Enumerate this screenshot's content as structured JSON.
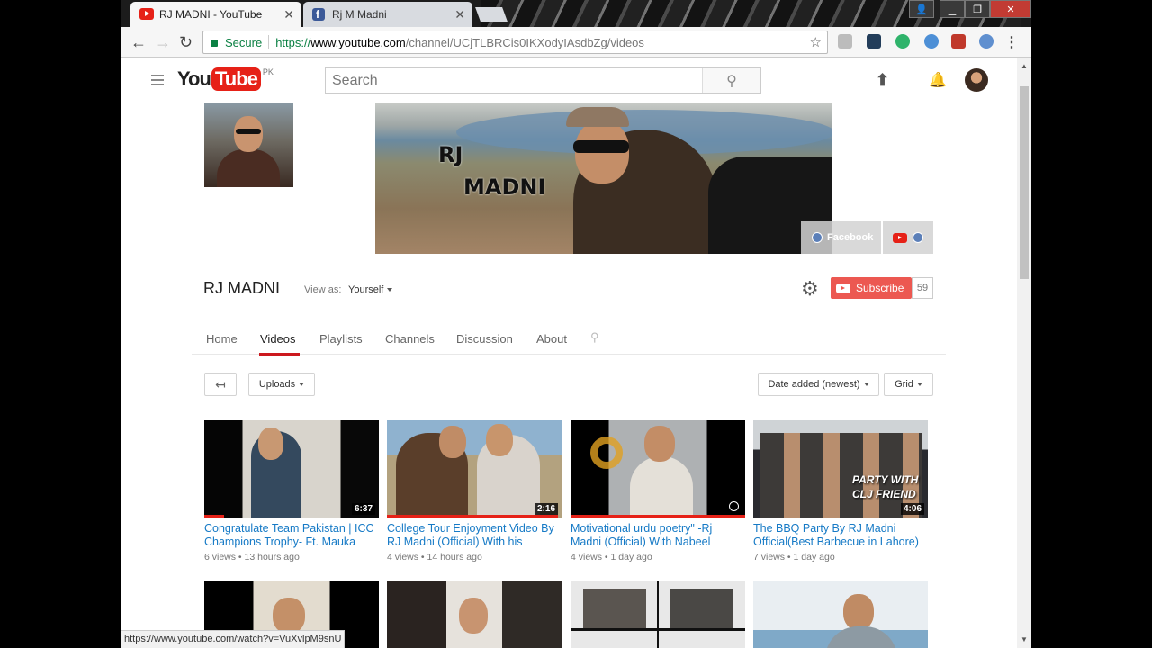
{
  "browser": {
    "tabs": [
      {
        "title": "RJ MADNI - YouTube",
        "active": true
      },
      {
        "title": "Rj M Madni",
        "active": false
      }
    ],
    "address": {
      "secure_label": "Secure",
      "url_scheme": "https://",
      "url_host": "www.youtube.com",
      "url_path": "/channel/UCjTLBRCis0IKXodyIAsdbZg/videos"
    },
    "status_url": "https://www.youtube.com/watch?v=VuXvlpM9snU"
  },
  "masthead": {
    "logo_you": "You",
    "logo_tube": "Tube",
    "region": "PK",
    "search_placeholder": "Search"
  },
  "channel": {
    "name": "RJ MADNI",
    "banner_text_1": "RJ",
    "banner_text_2": "MADNI",
    "links": {
      "facebook": "Facebook"
    },
    "view_as_label": "View as:",
    "view_as_value": "Yourself",
    "subscribe_label": "Subscribe",
    "subscriber_count": "59",
    "tabs": [
      "Home",
      "Videos",
      "Playlists",
      "Channels",
      "Discussion",
      "About"
    ],
    "active_tab": "Videos"
  },
  "filters": {
    "uploads": "Uploads",
    "sort": "Date added (newest)",
    "view": "Grid"
  },
  "videos": [
    {
      "title": "Congratulate Team Pakistan | ICC Champions Trophy- Ft. Mauka",
      "duration": "6:37",
      "views": "6 views",
      "age": "13 hours ago"
    },
    {
      "title": "College Tour Enjoyment Video By RJ Madni (Official) With his",
      "duration": "2:16",
      "views": "4 views",
      "age": "14 hours ago"
    },
    {
      "title": "Motivational urdu poetry\" -Rj Madni (Official) With Nabeel",
      "duration": "",
      "views": "4 views",
      "age": "1 day ago"
    },
    {
      "title": "The BBQ Party By RJ Madni Official(Best Barbecue in Lahore)",
      "duration": "4:06",
      "views": "7 views",
      "age": "1 day ago",
      "overlay_text": "PARTY WITH CLJ FRIEND"
    }
  ],
  "colors": {
    "youtube_red": "#e62117",
    "link_blue": "#167ac6"
  }
}
